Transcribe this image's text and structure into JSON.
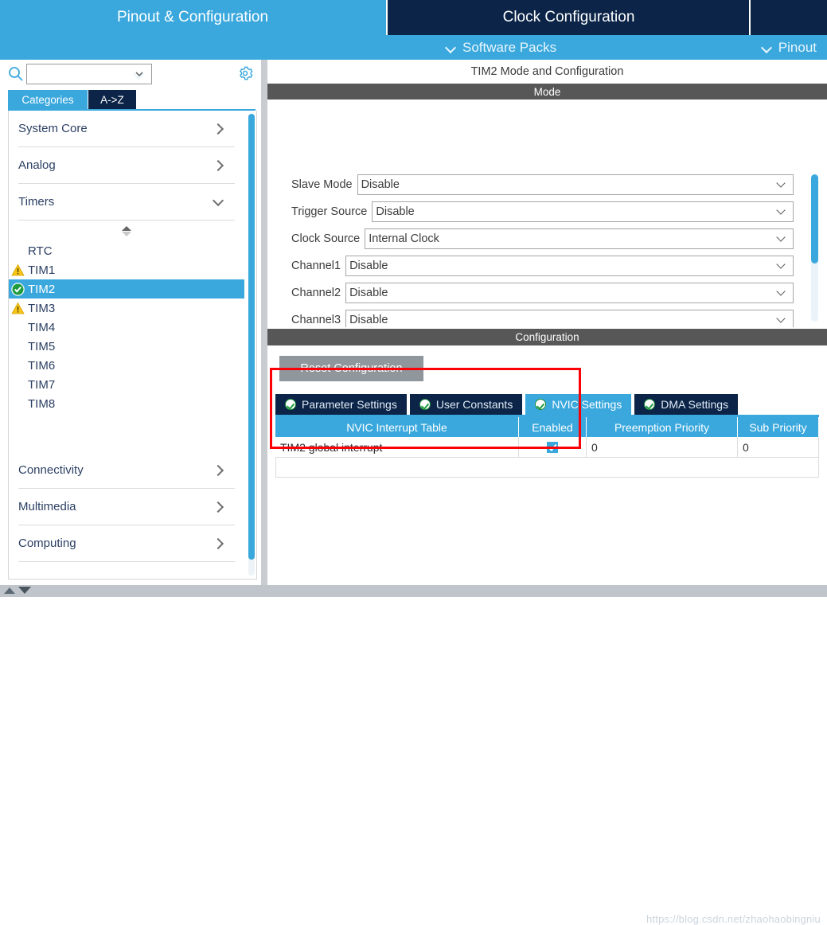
{
  "header": {
    "tabs": [
      {
        "label": "Pinout & Configuration",
        "active": true
      },
      {
        "label": "Clock Configuration",
        "active": false
      },
      {
        "label": "",
        "active": false
      }
    ],
    "subnav": [
      {
        "label": "Software Packs",
        "icon": "chevron-down-icon"
      },
      {
        "label": "Pinout",
        "icon": "chevron-down-icon"
      }
    ]
  },
  "sidebar": {
    "search": {
      "value": "",
      "placeholder": "",
      "icon": "search-icon",
      "dropdown_icon": "chevron-down-icon"
    },
    "gear_icon": "gear-icon",
    "view_tabs": [
      {
        "label": "Categories",
        "selected": true
      },
      {
        "label": "A->Z",
        "selected": false
      }
    ],
    "categories": [
      {
        "label": "System Core",
        "state": "collapsed"
      },
      {
        "label": "Analog",
        "state": "collapsed"
      },
      {
        "label": "Timers",
        "state": "expanded"
      }
    ],
    "timers": [
      {
        "label": "RTC",
        "badge": "none",
        "selected": false
      },
      {
        "label": "TIM1",
        "badge": "warning",
        "selected": false
      },
      {
        "label": "TIM2",
        "badge": "ok",
        "selected": true
      },
      {
        "label": "TIM3",
        "badge": "warning",
        "selected": false
      },
      {
        "label": "TIM4",
        "badge": "none",
        "selected": false
      },
      {
        "label": "TIM5",
        "badge": "none",
        "selected": false
      },
      {
        "label": "TIM6",
        "badge": "none",
        "selected": false
      },
      {
        "label": "TIM7",
        "badge": "none",
        "selected": false
      },
      {
        "label": "TIM8",
        "badge": "none",
        "selected": false
      }
    ],
    "categories_bottom": [
      {
        "label": "Connectivity",
        "state": "collapsed"
      },
      {
        "label": "Multimedia",
        "state": "collapsed"
      },
      {
        "label": "Computing",
        "state": "collapsed"
      }
    ]
  },
  "main": {
    "panel_title": "TIM2 Mode and Configuration",
    "mode_section_title": "Mode",
    "mode_fields": [
      {
        "label": "Slave Mode",
        "value": "Disable"
      },
      {
        "label": "Trigger Source",
        "value": "Disable"
      },
      {
        "label": "Clock Source",
        "value": "Internal Clock"
      },
      {
        "label": "Channel1",
        "value": "Disable"
      },
      {
        "label": "Channel2",
        "value": "Disable"
      },
      {
        "label": "Channel3",
        "value": "Disable"
      }
    ],
    "configuration_section_title": "Configuration",
    "reset_button": "Reset Configuration",
    "config_tabs": [
      {
        "label": "Parameter Settings",
        "badge": "ok",
        "active": false
      },
      {
        "label": "User Constants",
        "badge": "ok",
        "active": false
      },
      {
        "label": "NVIC Settings",
        "badge": "ok",
        "active": true
      },
      {
        "label": "DMA Settings",
        "badge": "ok",
        "active": false
      }
    ],
    "nvic_table": {
      "columns": [
        "NVIC Interrupt Table",
        "Enabled",
        "Preemption Priority",
        "Sub Priority"
      ],
      "rows": [
        {
          "name": "TIM2 global interrupt",
          "enabled": true,
          "preemption_priority": "0",
          "sub_priority": "0"
        }
      ]
    }
  },
  "watermark": "https://blog.csdn.net/zhaohaobingniu",
  "colors": {
    "accent": "#3aa8dd",
    "dark_tab": "#0b2447",
    "section_header": "#575757",
    "annotation": "#fb0007",
    "ok_green": "#1e9c3f",
    "warn_yellow": "#f5c518"
  }
}
